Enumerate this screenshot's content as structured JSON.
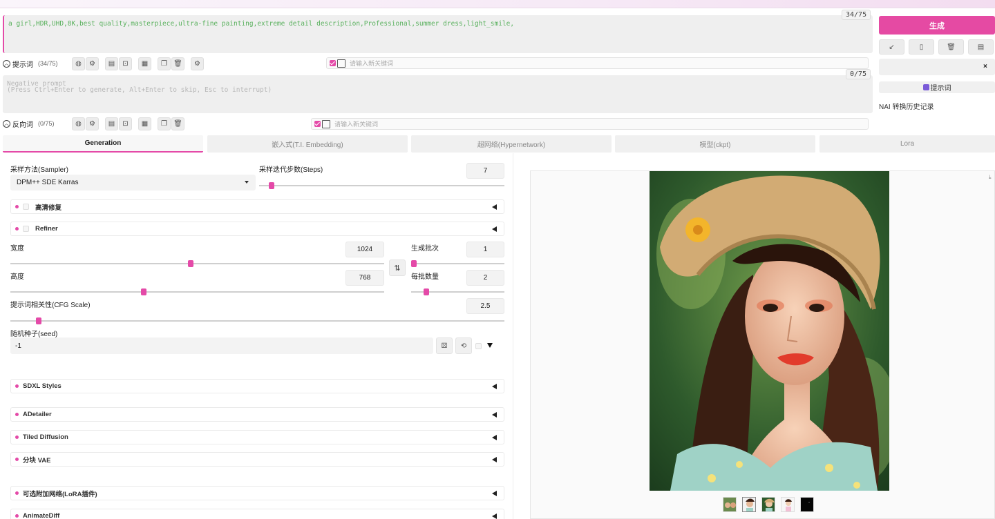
{
  "prompt": {
    "text": "a girl,HDR,UHD,8K,best quality,masterpiece,ultra-fine painting,extreme detail description,Professional,summer  dress,light_smile,",
    "counter": "34/75",
    "toggle_label": "提示词",
    "toggle_count": "(34/75)",
    "keyword_placeholder": "请输入新关键词"
  },
  "negative": {
    "placeholder_line1": "Negative prompt",
    "placeholder_line2": "(Press Ctrl+Enter to generate, Alt+Enter to skip, Esc to interrupt)",
    "counter": "0/75",
    "toggle_label": "反向词",
    "toggle_count": "(0/75)",
    "keyword_placeholder": "请输入新关键词"
  },
  "right": {
    "generate": "生成",
    "prompt_button": "提示词",
    "nai_history": "NAI 转换历史记录",
    "close": "×"
  },
  "tabs": [
    "Generation",
    "嵌入式(T.I. Embedding)",
    "超网络(Hypernetwork)",
    "模型(ckpt)",
    "Lora"
  ],
  "settings": {
    "sampler_label": "采样方法(Sampler)",
    "sampler_value": "DPM++ SDE Karras",
    "steps_label": "采样迭代步数(Steps)",
    "steps_value": "7",
    "hires_label": "高清修复",
    "refiner_label": "Refiner",
    "width_label": "宽度",
    "width_value": "1024",
    "height_label": "高度",
    "height_value": "768",
    "batch_count_label": "生成批次",
    "batch_count_value": "1",
    "batch_size_label": "每批数量",
    "batch_size_value": "2",
    "cfg_label": "提示词相关性(CFG Scale)",
    "cfg_value": "2.5",
    "seed_label": "随机种子(seed)",
    "seed_value": "-1"
  },
  "accordions": [
    "SDXL Styles",
    "ADetailer",
    "Tiled Diffusion",
    "分块 VAE",
    "可选附加网络(LoRA插件)",
    "AnimateDiff"
  ],
  "colors": {
    "accent": "#e54aa3",
    "prompt_text": "#58b05c"
  }
}
